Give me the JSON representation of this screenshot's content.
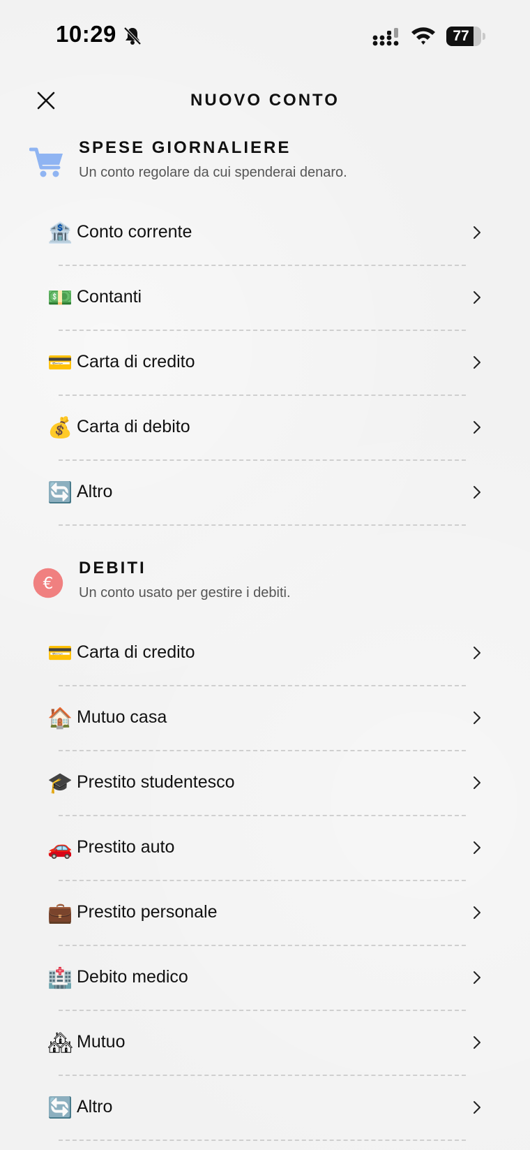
{
  "status_bar": {
    "time": "10:29",
    "battery": "77",
    "battery_level": 0.77,
    "icons": [
      "bell-slash-icon",
      "cellular-signal-icon",
      "wifi-icon",
      "battery-icon"
    ]
  },
  "header": {
    "title": "NUOVO CONTO",
    "close_icon": "close-icon"
  },
  "sections": [
    {
      "title": "SPESE GIORNALIERE",
      "description": "Un conto regolare da cui spenderai denaro.",
      "icon": "shopping-cart-icon",
      "icon_color": "#8fb4f2",
      "items": [
        {
          "emoji": "🏦",
          "label": "Conto corrente"
        },
        {
          "emoji": "💵",
          "label": "Contanti"
        },
        {
          "emoji": "💳",
          "label": "Carta di credito"
        },
        {
          "emoji": "💰",
          "label": "Carta di debito"
        },
        {
          "emoji": "🔄",
          "label": "Altro"
        }
      ]
    },
    {
      "title": "DEBITI",
      "description": "Un conto usato per gestire i debiti.",
      "icon": "euro-coin-icon",
      "icon_color": "#f08080",
      "icon_glyph": "€",
      "items": [
        {
          "emoji": "💳",
          "label": "Carta di credito"
        },
        {
          "emoji": "🏠",
          "label": "Mutuo casa"
        },
        {
          "emoji": "🎓",
          "label": "Prestito studentesco"
        },
        {
          "emoji": "🚗",
          "label": "Prestito auto"
        },
        {
          "emoji": "💼",
          "label": "Prestito personale"
        },
        {
          "emoji": "🏥",
          "label": "Debito medico"
        },
        {
          "emoji": "🏘",
          "label": "Mutuo"
        },
        {
          "emoji": "🔄",
          "label": "Altro"
        }
      ]
    }
  ]
}
